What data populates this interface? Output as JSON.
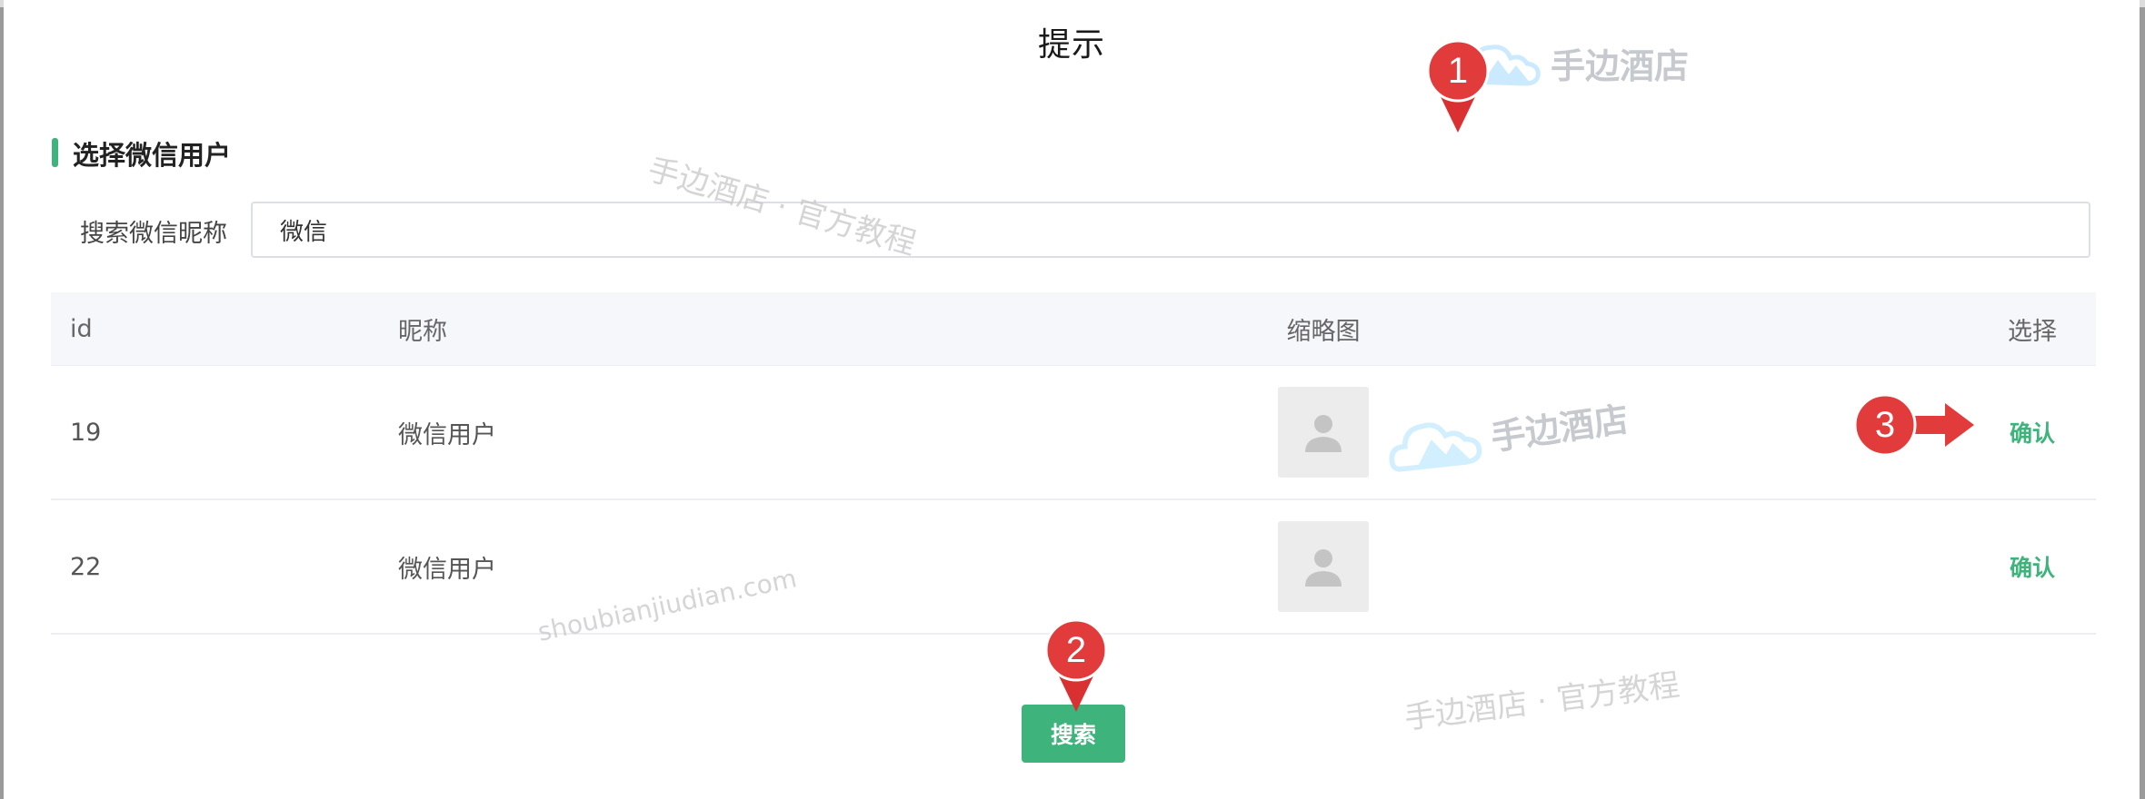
{
  "dialog": {
    "title": "提示",
    "section_title": "选择微信用户",
    "search": {
      "label": "搜索微信昵称",
      "value": "微信",
      "placeholder": ""
    },
    "table": {
      "columns": [
        "id",
        "昵称",
        "缩略图",
        "选择"
      ],
      "rows": [
        {
          "id": "19",
          "nickname": "微信用户",
          "thumbnail": "avatar-placeholder",
          "action": "确认"
        },
        {
          "id": "22",
          "nickname": "微信用户",
          "thumbnail": "avatar-placeholder",
          "action": "确认"
        }
      ]
    },
    "search_button": "搜索"
  },
  "annotations": {
    "marker1": "1",
    "marker2": "2",
    "marker3": "3"
  },
  "watermarks": {
    "brand": "手边酒店",
    "tutorial": "手边酒店 · 官方教程",
    "domain": "shoubianjiudian.com"
  },
  "colors": {
    "accent": "#3eb37c",
    "marker": "#e03a3a"
  }
}
